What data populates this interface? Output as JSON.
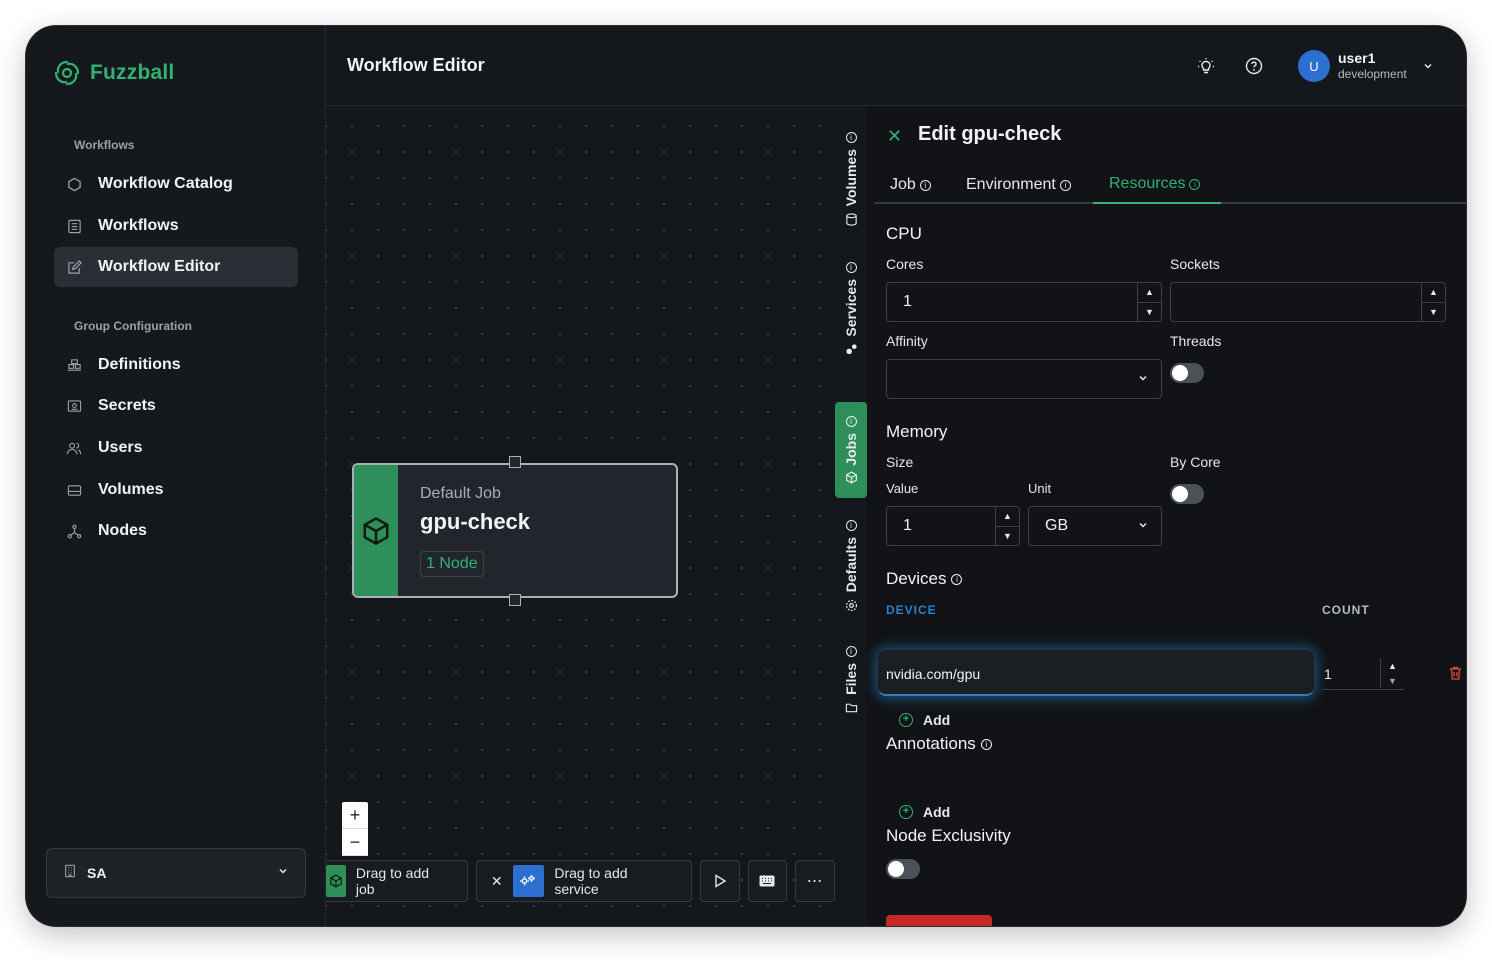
{
  "brand": {
    "name": "Fuzzball"
  },
  "sidebar": {
    "section_workflows": "Workflows",
    "workflow_items": [
      {
        "label": "Workflow Catalog",
        "icon": "hexagon-icon"
      },
      {
        "label": "Workflows",
        "icon": "list-icon"
      },
      {
        "label": "Workflow Editor",
        "icon": "edit-icon",
        "active": true
      }
    ],
    "section_group": "Group Configuration",
    "group_items": [
      {
        "label": "Definitions",
        "icon": "stack-icon"
      },
      {
        "label": "Secrets",
        "icon": "secret-icon"
      },
      {
        "label": "Users",
        "icon": "users-icon"
      },
      {
        "label": "Volumes",
        "icon": "drive-icon"
      },
      {
        "label": "Nodes",
        "icon": "nodes-icon"
      }
    ],
    "org": {
      "label": "SA"
    }
  },
  "header": {
    "title": "Workflow Editor",
    "user": {
      "initial": "U",
      "name": "user1",
      "env": "development"
    }
  },
  "canvas": {
    "node": {
      "kind": "Default Job",
      "name": "gpu-check",
      "badge": "1 Node"
    },
    "zoom": {
      "in": "+",
      "out": "−"
    },
    "toolbar": {
      "add_job": "Drag to add job",
      "add_service": "Drag to add service"
    }
  },
  "rail": {
    "volumes": "Volumes",
    "services": "Services",
    "jobs": "Jobs",
    "defaults": "Defaults",
    "files": "Files"
  },
  "panel": {
    "title": "Edit gpu-check",
    "tabs": [
      "Job",
      "Environment",
      "Resources"
    ],
    "active_tab": "Resources",
    "cpu": {
      "heading": "CPU",
      "cores_label": "Cores",
      "cores_value": "1",
      "sockets_label": "Sockets",
      "sockets_value": "",
      "affinity_label": "Affinity",
      "affinity_value": "",
      "threads_label": "Threads",
      "threads_on": false
    },
    "memory": {
      "heading": "Memory",
      "size_label": "Size",
      "value_label": "Value",
      "value": "1",
      "unit_label": "Unit",
      "unit": "GB",
      "bycore_label": "By Core",
      "bycore_on": false
    },
    "devices": {
      "heading": "Devices",
      "col_device": "DEVICE",
      "col_count": "COUNT",
      "rows": [
        {
          "device": "nvidia.com/gpu",
          "count": "1"
        }
      ],
      "add_label": "Add"
    },
    "annotations": {
      "heading": "Annotations",
      "add_label": "Add"
    },
    "exclusivity": {
      "heading": "Node Exclusivity",
      "on": false
    }
  },
  "colors": {
    "accent": "#2fb273",
    "focus": "#2d7fc8",
    "danger": "#c62828"
  }
}
